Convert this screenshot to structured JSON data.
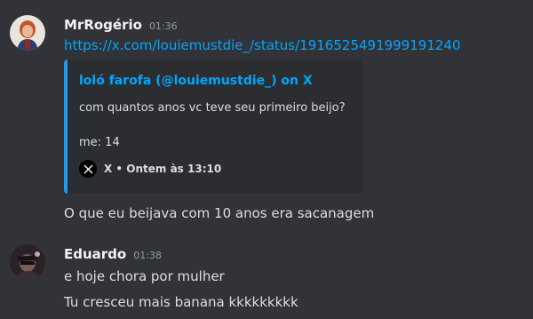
{
  "messages": [
    {
      "username": "MrRogério",
      "timestamp": "01:36",
      "link": "https://x.com/louiemustdie_/status/1916525491999191240",
      "embed": {
        "author": "loló farofa (@louiemustdie_) on X",
        "line1": "com quantos anos vc teve seu primeiro beijo?",
        "line2": "me: 14",
        "footer": "X • Ontem às 13:10",
        "accent_color": "#1d9bf0",
        "icon": "x-logo-icon"
      },
      "text": "O que eu beijava com 10 anos era sacanagem"
    },
    {
      "username": "Eduardo",
      "timestamp": "01:38",
      "lines": [
        "e hoje chora por mulher",
        "Tu cresceu mais banana kkkkkkkkk"
      ]
    }
  ]
}
